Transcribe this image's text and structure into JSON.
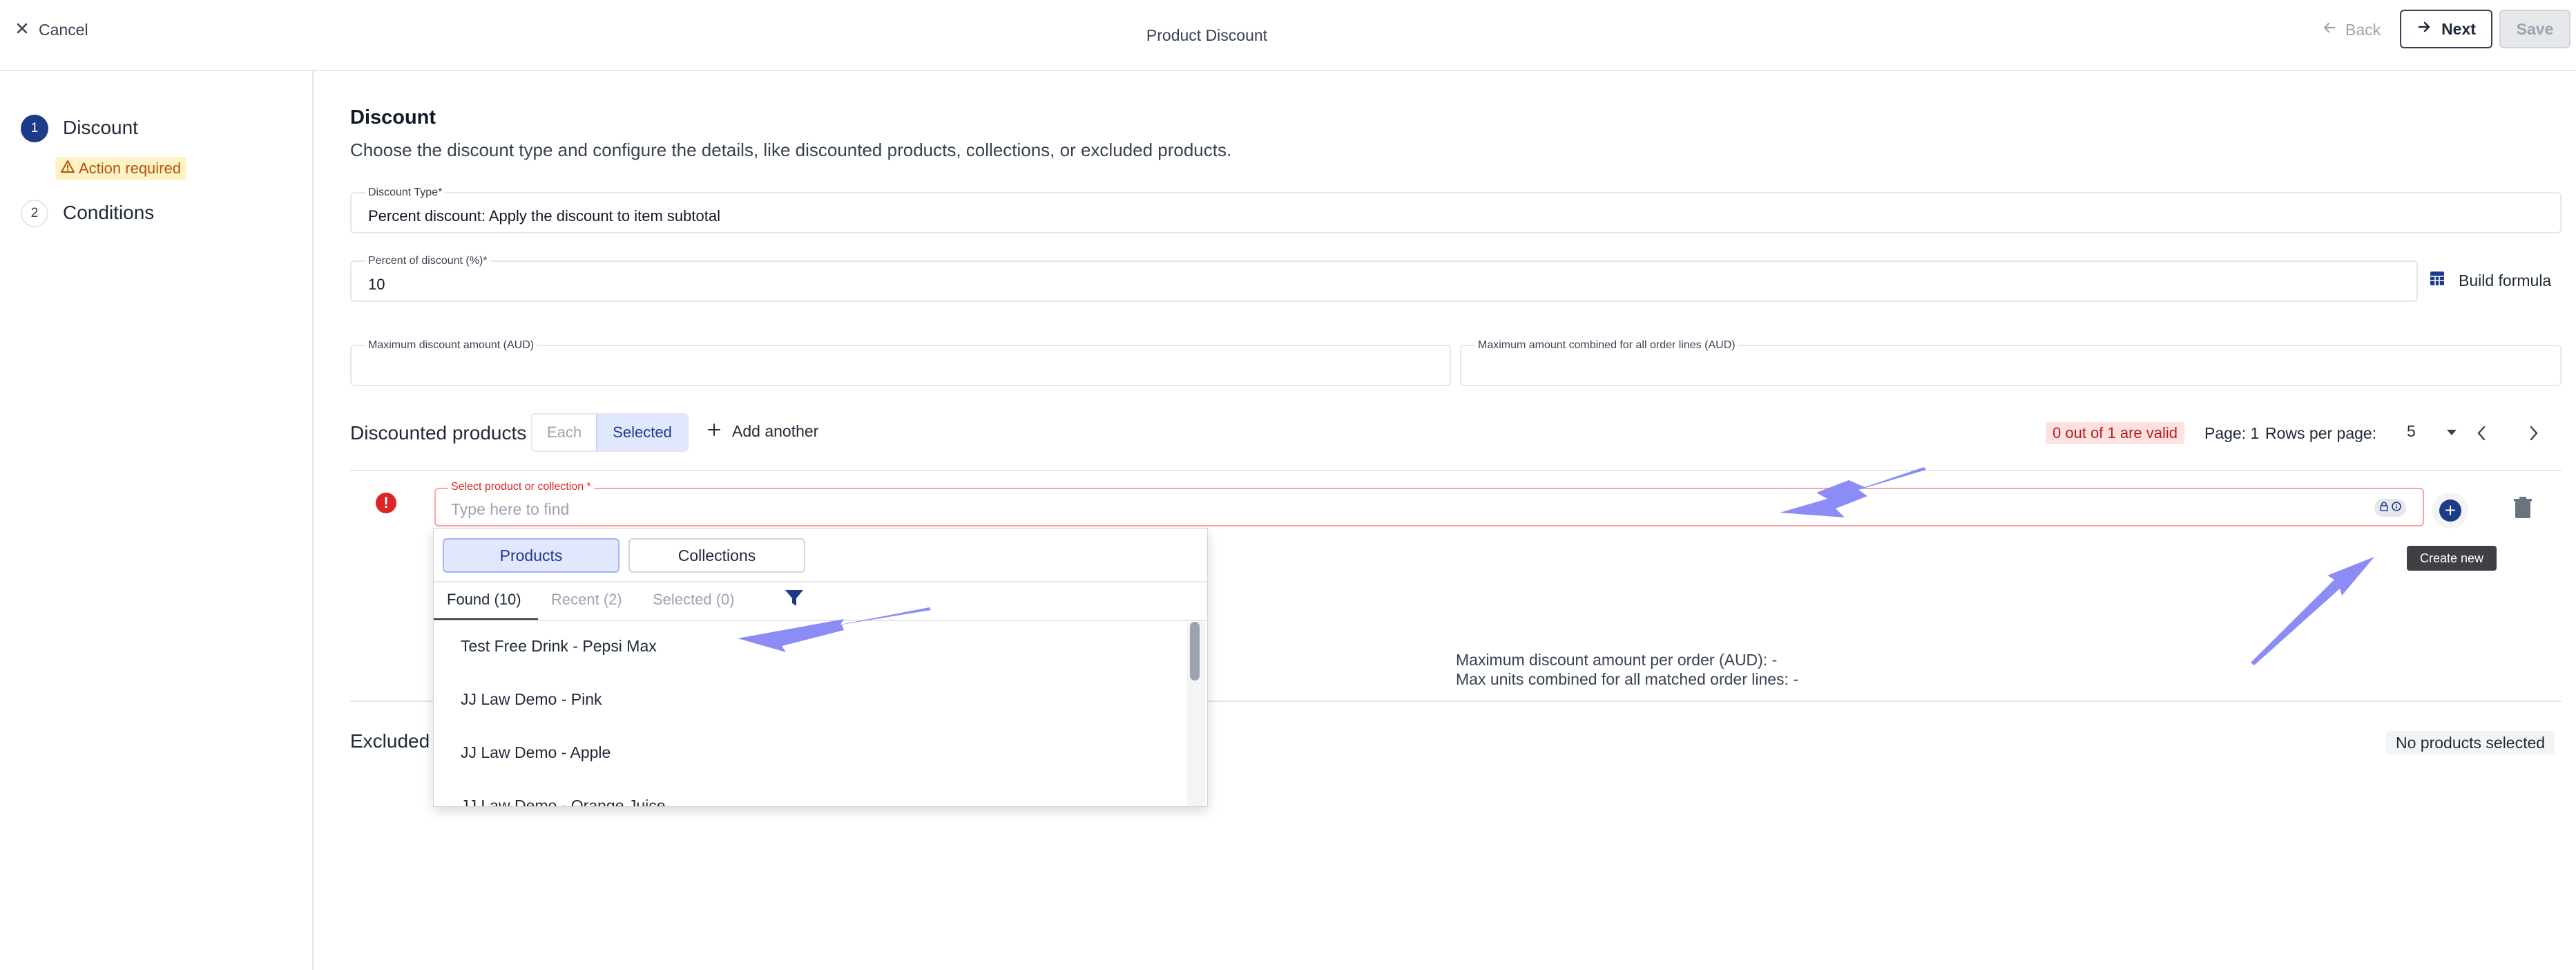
{
  "header": {
    "cancel_label": "Cancel",
    "title": "Product Discount",
    "back_label": "Back",
    "next_label": "Next",
    "save_label": "Save"
  },
  "sidebar": {
    "steps": [
      {
        "number": "1",
        "label": "Discount",
        "badge": "Action required",
        "status": "active"
      },
      {
        "number": "2",
        "label": "Conditions"
      }
    ]
  },
  "main": {
    "title": "Discount",
    "description": "Choose the discount type and configure the details, like discounted products, collections, or excluded products.",
    "discount_type": {
      "label": "Discount Type*",
      "value": "Percent discount: Apply the discount to item subtotal"
    },
    "percent": {
      "label": "Percent of discount (%)*",
      "value": "10"
    },
    "build_formula_label": "Build formula",
    "max_discount": {
      "label": "Maximum discount amount (AUD)",
      "value": ""
    },
    "max_combined": {
      "label": "Maximum amount combined for all order lines (AUD)",
      "value": ""
    },
    "discounted_products": {
      "label": "Discounted products",
      "segments": [
        "Each",
        "Selected"
      ],
      "selected_segment": "Selected",
      "add_another_label": "Add another",
      "valid_badge": "0 out of 1 are valid",
      "page_label": "Page: 1",
      "rows_label": "Rows per page:",
      "rows_value": "5"
    },
    "select_field": {
      "label": "Select product or collection *",
      "placeholder": "Type here to find",
      "tooltip": "Create new"
    },
    "max_info": [
      "Maximum discount amount per order (AUD): -",
      "Max units combined for all matched order lines: -"
    ],
    "excluded": {
      "label": "Excluded p",
      "badge": "No products selected"
    }
  },
  "dropdown": {
    "toggles": [
      "Products",
      "Collections"
    ],
    "active_toggle": "Products",
    "tabs": [
      "Found (10)",
      "Recent (2)",
      "Selected (0)"
    ],
    "active_tab": "Found (10)",
    "items": [
      "Test Free Drink - Pepsi Max",
      "JJ Law Demo - Pink",
      "JJ Law Demo - Apple",
      "JJ Law Demo - Orange Juice"
    ]
  },
  "colors": {
    "accent": "#1e3a8a",
    "error": "#dc2626",
    "warning_bg": "#fef3c7",
    "annotation_arrow": "#8b8cf6"
  }
}
